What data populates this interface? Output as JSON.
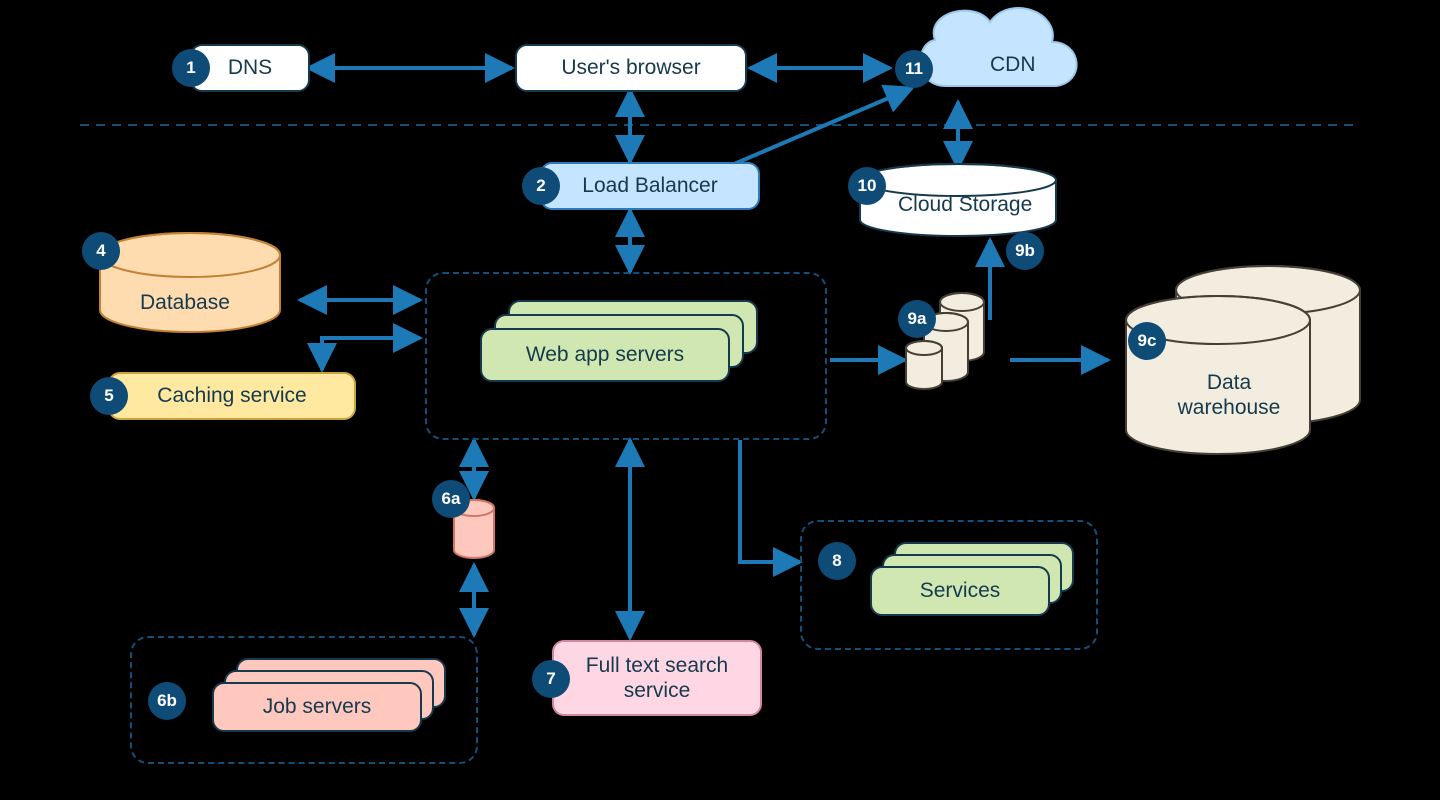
{
  "colors": {
    "badge": "#0e4c77",
    "arrow": "#1e7ab7",
    "dash": "#144f78"
  },
  "nodes": {
    "dns": {
      "id": "1",
      "label": "DNS"
    },
    "browser": {
      "label": "User's browser"
    },
    "cdn": {
      "id": "11",
      "label": "CDN"
    },
    "load_balancer": {
      "id": "2",
      "label": "Load Balancer"
    },
    "database": {
      "id": "4",
      "label": "Database"
    },
    "caching": {
      "id": "5",
      "label": "Caching service"
    },
    "web_app": {
      "label": "Web app servers"
    },
    "job_queue": {
      "id": "6a"
    },
    "job_servers": {
      "id": "6b",
      "label": "Job servers"
    },
    "fulltext": {
      "id": "7",
      "label": "Full text search service"
    },
    "services": {
      "id": "8",
      "label": "Services"
    },
    "datapipe": {
      "id": "9a"
    },
    "cloud_to_9b": {
      "id": "9b"
    },
    "cloud_storage": {
      "id": "10",
      "label": "Cloud Storage"
    },
    "warehouse": {
      "id": "9c",
      "label": "Data warehouse"
    }
  },
  "connections": [
    {
      "from": "dns",
      "to": "browser",
      "bidir": true
    },
    {
      "from": "browser",
      "to": "cdn",
      "bidir": true
    },
    {
      "from": "browser",
      "to": "load_balancer",
      "bidir": true
    },
    {
      "from": "cdn",
      "to": "load_balancer",
      "bidir": false
    },
    {
      "from": "cdn",
      "to": "cloud_storage",
      "bidir": true
    },
    {
      "from": "load_balancer",
      "to": "web_app",
      "bidir": true
    },
    {
      "from": "database",
      "to": "web_app",
      "bidir": true
    },
    {
      "from": "caching",
      "to": "web_app",
      "bidir": true
    },
    {
      "from": "web_app",
      "to": "job_queue",
      "bidir": true
    },
    {
      "from": "job_queue",
      "to": "job_servers",
      "bidir": true
    },
    {
      "from": "web_app",
      "to": "fulltext",
      "bidir": true
    },
    {
      "from": "web_app",
      "to": "services",
      "bidir": false
    },
    {
      "from": "web_app",
      "to": "datapipe",
      "bidir": false
    },
    {
      "from": "datapipe",
      "to": "cloud_storage",
      "bidir": false
    },
    {
      "from": "datapipe",
      "to": "warehouse",
      "bidir": false
    }
  ]
}
